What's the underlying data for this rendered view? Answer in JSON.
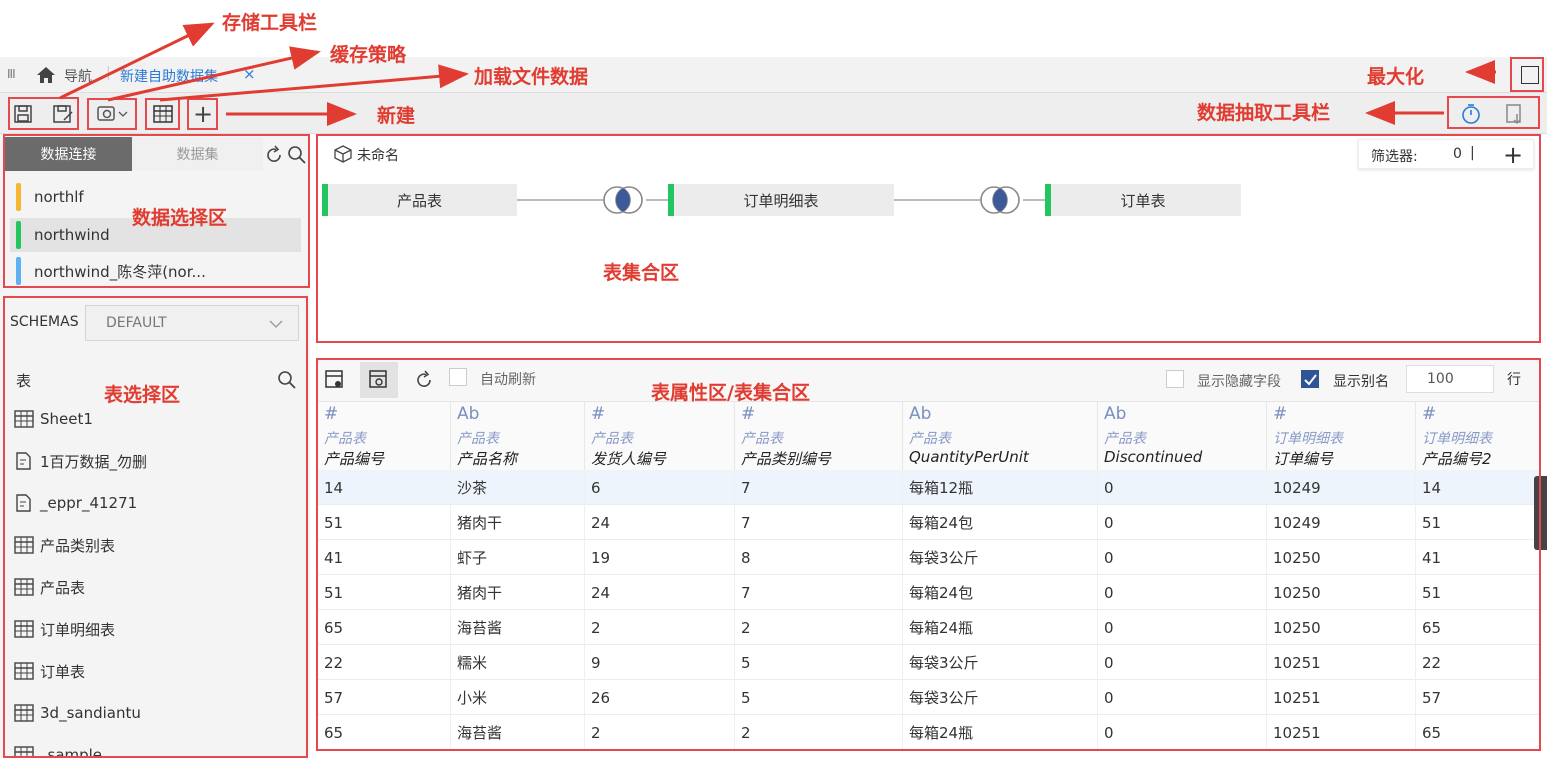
{
  "annotations": {
    "storage_toolbar": "存储工具栏",
    "cache_strategy": "缓存策略",
    "load_file_data": "加载文件数据",
    "new": "新建",
    "maximize": "最大化",
    "extract_toolbar": "数据抽取工具栏",
    "data_select_area": "数据选择区",
    "table_set_area": "表集合区",
    "table_select_area": "表选择区",
    "table_prop_area": "表属性区/表集合区"
  },
  "topbar": {
    "menu_icon": "III",
    "home_label": "导航",
    "tab_label": "新建自助数据集",
    "tab_close": "×"
  },
  "toolbar": {
    "new_symbol": "+"
  },
  "left": {
    "tab_connection": "数据连接",
    "tab_dataset": "数据集",
    "connections": [
      {
        "label": "northlf",
        "color": "#f5b731"
      },
      {
        "label": "northwind",
        "color": "#22c55e"
      },
      {
        "label": "northwind_陈冬萍(nor...",
        "color": "#60b0f4"
      }
    ],
    "schemas_label": "SCHEMAS",
    "schema_value": "DEFAULT",
    "tables_label": "表",
    "tables": [
      {
        "label": "Sheet1",
        "icon": "table-icon"
      },
      {
        "label": "1百万数据_勿删",
        "icon": "sql-file-icon"
      },
      {
        "label": "_eppr_41271",
        "icon": "sql-file-icon"
      },
      {
        "label": "产品类别表",
        "icon": "table-icon"
      },
      {
        "label": "产品表",
        "icon": "table-icon"
      },
      {
        "label": "订单明细表",
        "icon": "table-icon"
      },
      {
        "label": "订单表",
        "icon": "table-icon"
      },
      {
        "label": "3d_sandiantu",
        "icon": "table-icon"
      },
      {
        "label": "_sample",
        "icon": "table-icon"
      }
    ]
  },
  "set_panel": {
    "name": "未命名",
    "filter_label": "筛选器:",
    "filter_count": "0",
    "add_symbol": "+",
    "nodes": [
      "产品表",
      "订单明细表",
      "订单表"
    ]
  },
  "prop_panel": {
    "auto_refresh": "自动刷新",
    "show_hidden": "显示隐藏字段",
    "show_alias": "显示别名",
    "rows_value": "100",
    "rows_unit": "行",
    "columns": [
      {
        "type": "#",
        "src": "产品表",
        "name": "产品编号"
      },
      {
        "type": "Ab",
        "src": "产品表",
        "name": "产品名称"
      },
      {
        "type": "#",
        "src": "产品表",
        "name": "发货人编号"
      },
      {
        "type": "#",
        "src": "产品表",
        "name": "产品类别编号"
      },
      {
        "type": "Ab",
        "src": "产品表",
        "name": "QuantityPerUnit"
      },
      {
        "type": "Ab",
        "src": "产品表",
        "name": "Discontinued"
      },
      {
        "type": "#",
        "src": "订单明细表",
        "name": "订单编号"
      },
      {
        "type": "#",
        "src": "订单明细表",
        "name": "产品编号2"
      }
    ],
    "rows": [
      [
        "14",
        "沙茶",
        "6",
        "7",
        "每箱12瓶",
        "0",
        "10249",
        "14"
      ],
      [
        "51",
        "猪肉干",
        "24",
        "7",
        "每箱24包",
        "0",
        "10249",
        "51"
      ],
      [
        "41",
        "虾子",
        "19",
        "8",
        "每袋3公斤",
        "0",
        "10250",
        "41"
      ],
      [
        "51",
        "猪肉干",
        "24",
        "7",
        "每箱24包",
        "0",
        "10250",
        "51"
      ],
      [
        "65",
        "海苔酱",
        "2",
        "2",
        "每箱24瓶",
        "0",
        "10250",
        "65"
      ],
      [
        "22",
        "糯米",
        "9",
        "5",
        "每袋3公斤",
        "0",
        "10251",
        "22"
      ],
      [
        "57",
        "小米",
        "26",
        "5",
        "每袋3公斤",
        "0",
        "10251",
        "57"
      ],
      [
        "65",
        "海苔酱",
        "2",
        "2",
        "每箱24瓶",
        "0",
        "10251",
        "65"
      ]
    ]
  }
}
